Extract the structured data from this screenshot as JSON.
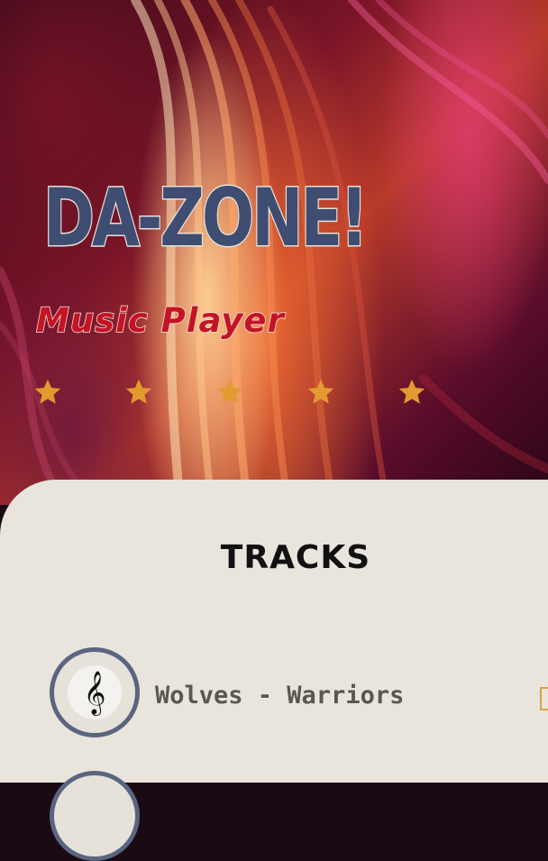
{
  "hero": {
    "brand_title": "DA-ZONE!",
    "subtitle": "Music Player",
    "rating": 5,
    "star_icon": "star-icon",
    "star_color": "#e39a2f"
  },
  "tracks_section": {
    "title": "TRACKS",
    "items": [
      {
        "name": "Wolves - Warriors",
        "icon": "treble-clef-icon",
        "glyph": "𝄞"
      }
    ]
  },
  "colors": {
    "panel_bg": "#e9e5dc",
    "disc_border": "#5a6580",
    "subtitle": "#c41424",
    "brand": "#3f4d72"
  }
}
